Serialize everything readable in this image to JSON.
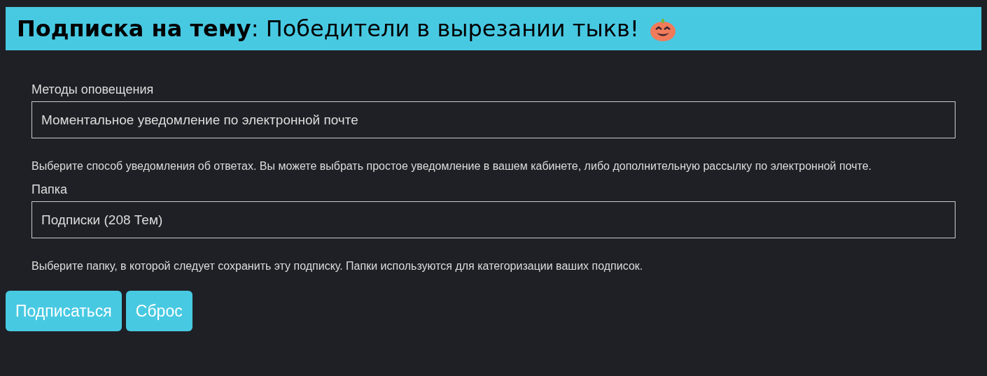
{
  "header": {
    "title": "**Подписка на тему**: Победители в вырезании тыкв!"
  },
  "fields": [
    {
      "label": "Методы оповещения",
      "value": "Моментальное уведомление по электронной почте",
      "hint": "Выберите способ уведомления об ответах. Вы можете выбрать простое уведомление в вашем кабинете, либо дополнительную рассылку по электронной почте."
    },
    {
      "label": "Папка",
      "value": "Подписки (208 Тем)",
      "hint": "Выберите папку, в которой следует сохранить эту подписку. Папки используются для категоризации ваших подписок."
    }
  ],
  "buttons": [
    "Подписаться",
    "Сброс"
  ]
}
